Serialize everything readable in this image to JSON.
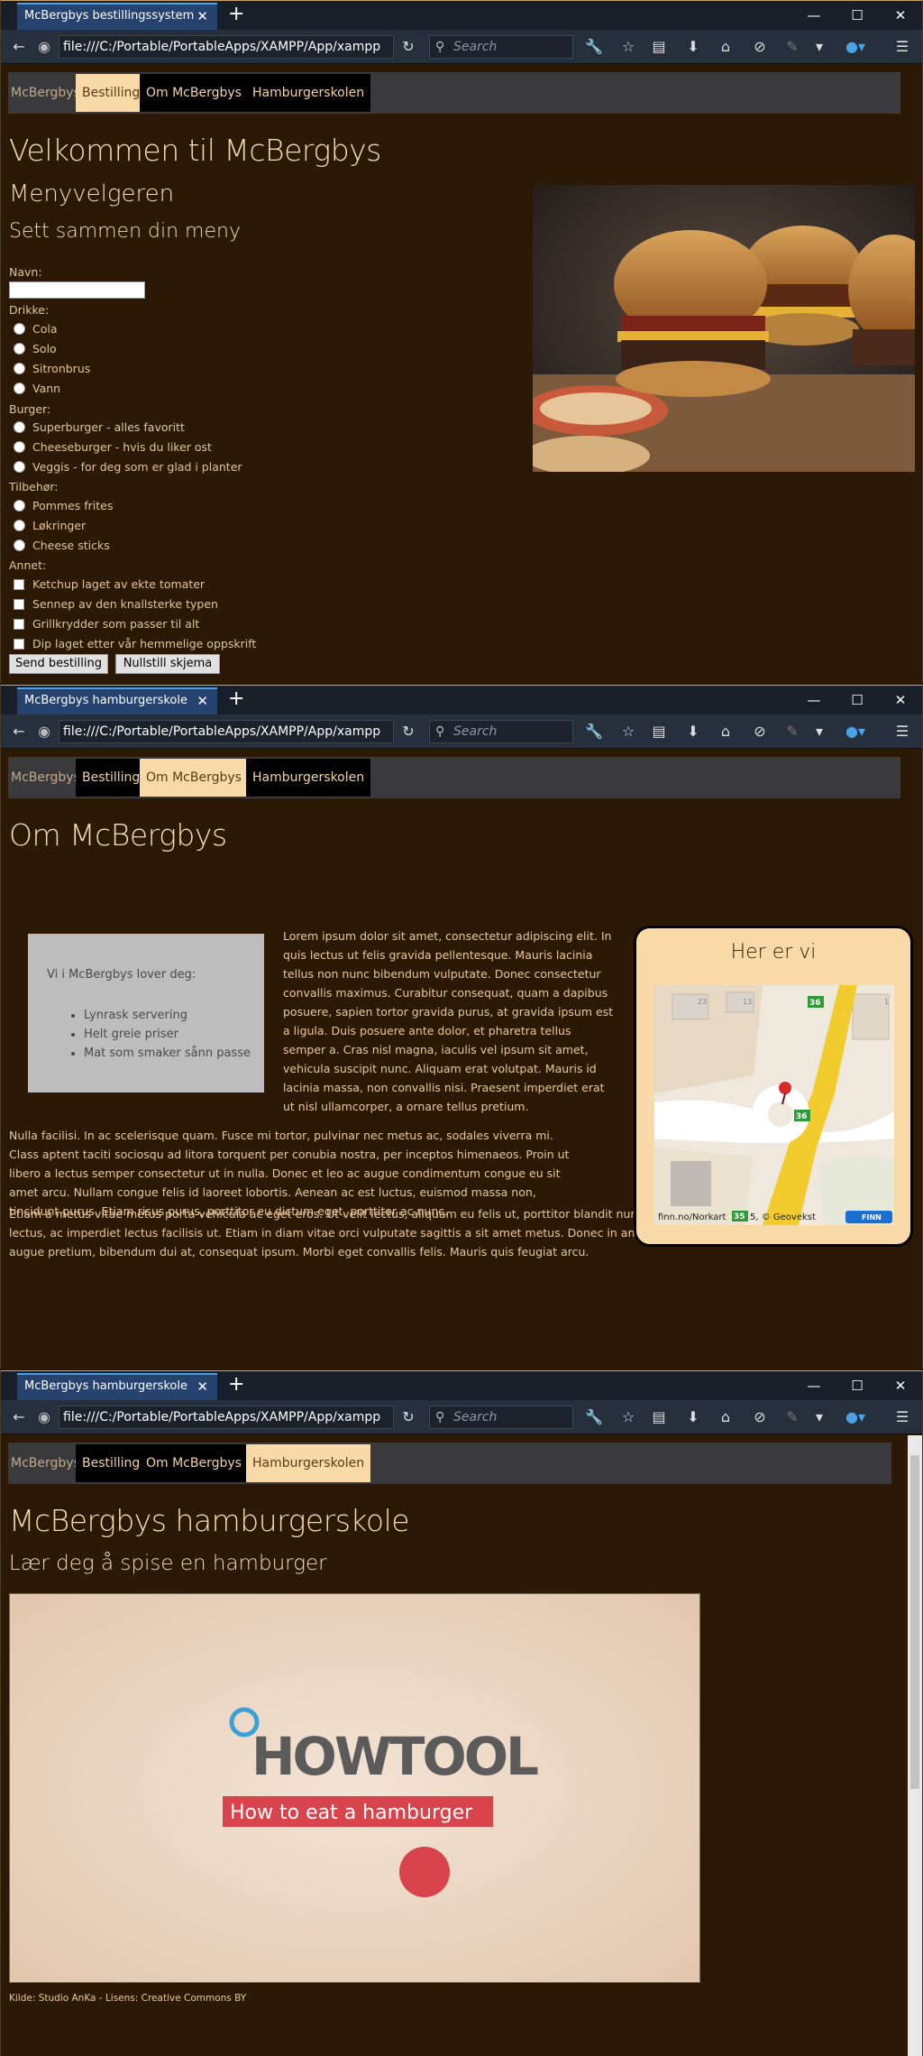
{
  "windows": [
    {
      "tab_title": "McBergbys bestillingssystem",
      "url": "file:///C:/Portable/PortableApps/XAMPP/App/xampp",
      "search_placeholder": "Search",
      "nav": [
        "McBergbys",
        "Bestilling",
        "Om McBergbys",
        "Hamburgerskolen"
      ],
      "heading": "Velkommen til McBergbys",
      "subheading": "Menyvelgeren",
      "form_title": "Sett sammen din meny",
      "name_label": "Navn:",
      "drinks_label": "Drikke:",
      "drinks": [
        "Cola",
        "Solo",
        "Sitronbrus",
        "Vann"
      ],
      "burger_label": "Burger:",
      "burgers": [
        "Superburger - alles favoritt",
        "Cheeseburger - hvis du liker ost",
        "Veggis - for deg som er glad i planter"
      ],
      "sides_label": "Tilbehør:",
      "sides": [
        "Pommes frites",
        "Løkringer",
        "Cheese sticks"
      ],
      "other_label": "Annet:",
      "other": [
        "Ketchup laget av ekte tomater",
        "Sennep av den knallsterke typen",
        "Grillkrydder som passer til alt",
        "Dip laget etter vår hemmelige oppskrift"
      ],
      "submit_label": "Send bestilling",
      "reset_label": "Nullstill skjema"
    },
    {
      "tab_title": "McBergbys hamburgerskole",
      "url": "file:///C:/Portable/PortableApps/XAMPP/App/xampp",
      "search_placeholder": "Search",
      "nav": [
        "McBergbys",
        "Bestilling",
        "Om McBergbys",
        "Hamburgerskolen"
      ],
      "heading": "Om McBergbys",
      "promise_title": "Vi i McBergbys lover deg:",
      "promises": [
        "Lynrask servering",
        "Helt greie priser",
        "Mat som smaker sånn passe"
      ],
      "paragraph1": "Lorem ipsum dolor sit amet, consectetur adipiscing elit. In quis lectus ut felis gravida pellentesque. Mauris lacinia tellus non nunc bibendum vulputate. Donec consectetur convallis maximus. Curabitur consequat, quam a dapibus posuere, sapien tortor gravida purus, at gravida ipsum est a ligula. Duis posuere ante dolor, et pharetra tellus semper a. Cras nisl magna, iaculis vel ipsum sit amet, vehicula suscipit nunc. Aliquam erat volutpat. Mauris id lacinia massa, non convallis nisi. Praesent imperdiet erat ut nisl ullamcorper, a ornare tellus pretium.",
      "paragraph2": "Nulla facilisi. In ac scelerisque quam. Fusce mi tortor, pulvinar nec metus ac, sodales viverra mi. Class aptent taciti sociosqu ad litora torquent per conubia nostra, per inceptos himenaeos. Proin ut libero a lectus semper consectetur ut in nulla. Donec et leo ac augue condimentum congue eu sit amet arcu. Nullam congue felis id laoreet lobortis. Aenean ac est luctus, euismod massa non, tincidunt purus. Etiam risus purus, porttitor eu dictum eget, porttitor ac nunc.",
      "paragraph3": "Etiam a metus vitae metus porta vehicula ac eget eros. Ut velit lectus, aliquam eu felis ut, porttitor blandit nunc. Aliquam erat volutpat. Ut viverra erat lectus, ac imperdiet lectus facilisis ut. Etiam in diam vitae orci vulputate sagittis a sit amet metus. Donec in ante a massa egestas tincidunt. Aliquam ut augue pretium, bibendum dui at, consequat ipsum. Morbi eget convallis felis. Mauris quis feugiat arcu.",
      "map_title": "Her er vi",
      "map_credit": "finn.no/Norkart",
      "map_credit2": "5, © Geovekst",
      "map_road_label": "36",
      "map_road_label_bottom": "35",
      "map_numbers": [
        "23",
        "13",
        "1"
      ],
      "map_brand": "FINN"
    },
    {
      "tab_title": "McBergbys hamburgerskole",
      "url": "file:///C:/Portable/PortableApps/XAMPP/App/xampp",
      "search_placeholder": "Search",
      "nav": [
        "McBergbys",
        "Bestilling",
        "Om McBergbys",
        "Hamburgerskolen"
      ],
      "heading": "McBergbys hamburgerskole",
      "subheading": "Lær deg å spise en hamburger",
      "video_logo": "HOWTOOL",
      "video_caption": "How to eat a hamburger",
      "credit": "Kilde: Studio AnKa - Lisens: Creative Commons BY"
    }
  ],
  "colors": {
    "page_bg": "#2b1905",
    "text": "#f1d3a8",
    "nav_active": "#fad9a8",
    "tab_active": "#26426e"
  }
}
